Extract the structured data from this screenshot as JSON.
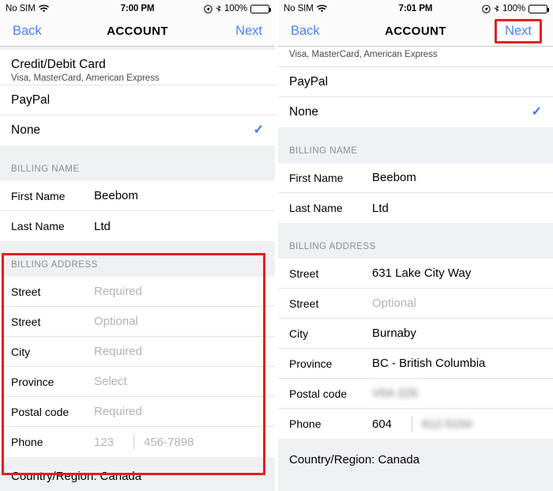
{
  "panels": [
    {
      "status_bar": {
        "carrier": "No SIM",
        "wifi_icon": "wifi-icon",
        "time": "7:00 PM",
        "location_icon": "location-services-icon",
        "bluetooth_icon": "bluetooth-icon",
        "battery_percent": "100%",
        "battery_icon": "battery-full-icon"
      },
      "nav": {
        "back_label": "Back",
        "title": "ACCOUNT",
        "next_label": "Next",
        "next_highlighted": false
      },
      "payment_methods": [
        {
          "title": "Credit/Debit Card",
          "subtitle": "Visa, MasterCard, American Express",
          "selected": false
        },
        {
          "title": "PayPal",
          "subtitle": "",
          "selected": false
        },
        {
          "title": "None",
          "subtitle": "",
          "selected": true
        }
      ],
      "billing_name": {
        "header": "BILLING NAME",
        "rows": [
          {
            "label": "First Name",
            "value": "Beebom",
            "is_placeholder": false
          },
          {
            "label": "Last Name",
            "value": "Ltd",
            "is_placeholder": false
          }
        ]
      },
      "billing_address": {
        "header": "BILLING ADDRESS",
        "highlighted": true,
        "rows": [
          {
            "label": "Street",
            "value": "Required",
            "is_placeholder": true
          },
          {
            "label": "Street",
            "value": "Optional",
            "is_placeholder": true
          },
          {
            "label": "City",
            "value": "Required",
            "is_placeholder": true
          },
          {
            "label": "Province",
            "value": "Select",
            "is_placeholder": true
          },
          {
            "label": "Postal code",
            "value": "Required",
            "is_placeholder": true
          }
        ],
        "phone": {
          "label": "Phone",
          "area_code": "123",
          "area_code_is_placeholder": true,
          "number": "456-7898",
          "number_is_placeholder": true,
          "number_is_blurred": false
        }
      },
      "footer_note": "Country/Region: Canada"
    },
    {
      "status_bar": {
        "carrier": "No SIM",
        "wifi_icon": "wifi-icon",
        "time": "7:01 PM",
        "location_icon": "location-services-icon",
        "bluetooth_icon": "bluetooth-icon",
        "battery_percent": "100%",
        "battery_icon": "battery-full-icon"
      },
      "nav": {
        "back_label": "Back",
        "title": "ACCOUNT",
        "next_label": "Next",
        "next_highlighted": true
      },
      "partial_top_row": "Visa, MasterCard, American Express",
      "payment_methods": [
        {
          "title": "PayPal",
          "subtitle": "",
          "selected": false
        },
        {
          "title": "None",
          "subtitle": "",
          "selected": true
        }
      ],
      "billing_name": {
        "header": "BILLING NAME",
        "rows": [
          {
            "label": "First Name",
            "value": "Beebom",
            "is_placeholder": false
          },
          {
            "label": "Last Name",
            "value": "Ltd",
            "is_placeholder": false
          }
        ]
      },
      "billing_address": {
        "header": "BILLING ADDRESS",
        "highlighted": false,
        "rows": [
          {
            "label": "Street",
            "value": "631 Lake City Way",
            "is_placeholder": false
          },
          {
            "label": "Street",
            "value": "Optional",
            "is_placeholder": true
          },
          {
            "label": "City",
            "value": "Burnaby",
            "is_placeholder": false
          },
          {
            "label": "Province",
            "value": "BC - British Columbia",
            "is_placeholder": false
          },
          {
            "label": "Postal code",
            "value": "V5A 2Z6",
            "is_placeholder": false,
            "is_blurred": true
          }
        ],
        "phone": {
          "label": "Phone",
          "area_code": "604",
          "area_code_is_placeholder": false,
          "number": "612-5154",
          "number_is_placeholder": false,
          "number_is_blurred": true
        }
      },
      "footer_note": "Country/Region: Canada"
    }
  ],
  "colors": {
    "accent_blue": "#4a84f0",
    "check_blue": "#3a76e8",
    "highlight_red": "#e02020",
    "group_bg": "#eff0f4",
    "cell_bg": "#ffffff",
    "placeholder_gray": "#b3b3b8"
  }
}
